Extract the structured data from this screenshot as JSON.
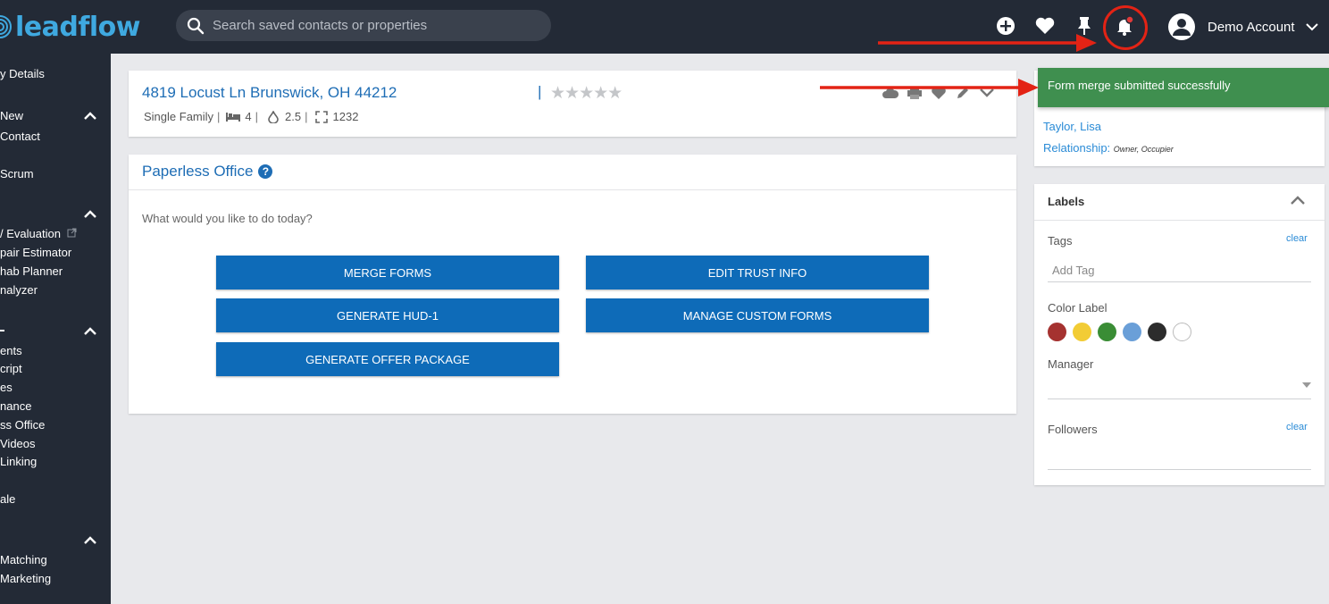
{
  "topbar": {
    "brand": "leadflow",
    "search_placeholder": "Search saved contacts or properties",
    "icons": [
      "add-circle-icon",
      "heart-icon",
      "pin-icon",
      "bell-icon"
    ],
    "account_name": "Demo Account"
  },
  "sidebar": {
    "items": [
      "y Details",
      "New",
      "Contact",
      "Scrum",
      "/ Evaluation",
      "pair Estimator",
      "hab Planner",
      "nalyzer",
      "ents",
      "cript",
      "es",
      "nance",
      "ss Office",
      "Videos",
      "Linking",
      "ale",
      "Matching",
      "Marketing"
    ]
  },
  "property": {
    "address": "4819 Locust Ln Brunswick, OH 44212",
    "separator": "|",
    "rating_stars": "★★★★★",
    "type": "Single Family",
    "beds": "4",
    "baths": "2.5",
    "sqft": "1232",
    "spec_separator": "|"
  },
  "paperless": {
    "title": "Paperless Office",
    "help_glyph": "?",
    "prompt": "What would you like to do today?",
    "buttons": {
      "merge_forms": "MERGE FORMS",
      "edit_trust": "EDIT TRUST INFO",
      "generate_hud": "GENERATE HUD-1",
      "manage_custom": "MANAGE CUSTOM FORMS",
      "offer_package": "GENERATE OFFER PACKAGE"
    }
  },
  "owner": {
    "name": "Taylor, Lisa",
    "relationship_label": "Relationship:",
    "relationship_value": "Owner, Occupier"
  },
  "toast": {
    "message": "Form merge submitted successfully",
    "color": "#3f8f4f"
  },
  "labels": {
    "title": "Labels",
    "tags_label": "Tags",
    "clear": "clear",
    "add_tag_placeholder": "Add Tag",
    "color_label": "Color Label",
    "colors": [
      "#a53230",
      "#f2cc35",
      "#3a8d35",
      "#6a9fd8",
      "#2c2c2c",
      "#ffffff"
    ],
    "manager_label": "Manager",
    "followers_label": "Followers"
  },
  "annotation_color": "#e32315"
}
